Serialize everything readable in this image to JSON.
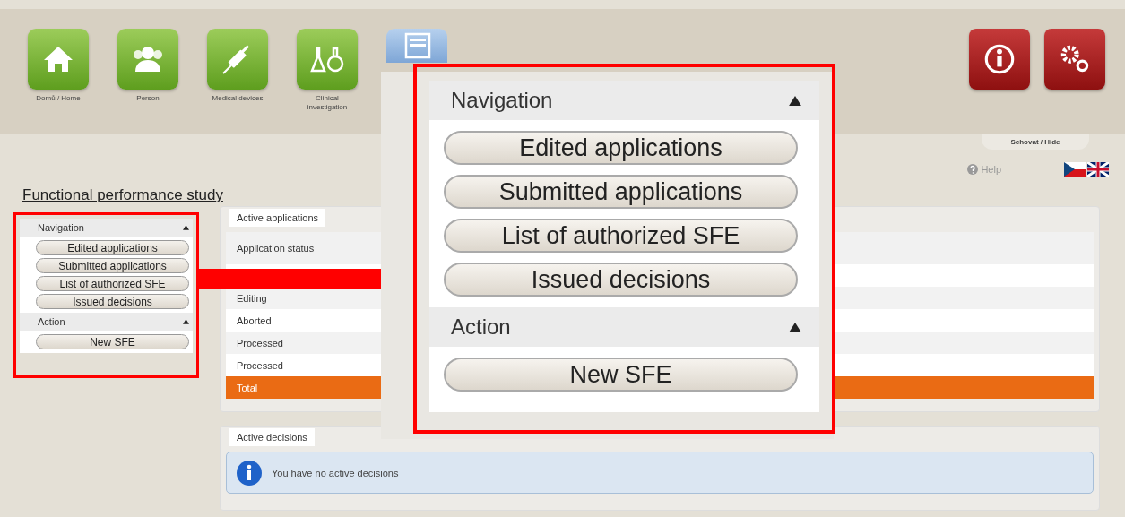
{
  "header": {
    "modules": [
      {
        "kind": "home",
        "label": "Domů / Home"
      },
      {
        "kind": "person",
        "label": "Person"
      },
      {
        "kind": "syringe",
        "label": "Medical devices"
      },
      {
        "kind": "flask",
        "label": "Clinical investigation"
      },
      {
        "kind": "document"
      }
    ],
    "tools": [
      {
        "kind": "info"
      },
      {
        "kind": "gears"
      }
    ]
  },
  "hide_tab": "Schovat / Hide",
  "help": "Help",
  "languages": [
    {
      "kind": "cz"
    },
    {
      "kind": "gb"
    }
  ],
  "page_title": "Functional performance study",
  "sidebar": {
    "sections": [
      {
        "title": "Navigation",
        "expanded": true,
        "buttons": [
          "Edited applications",
          "Submitted applications",
          "List of authorized SFE",
          "Issued decisions"
        ]
      },
      {
        "title": "Action",
        "expanded": true,
        "buttons": [
          "New SFE"
        ]
      }
    ]
  },
  "applications": {
    "tab": "Active applications",
    "column": "Application status",
    "rows": [
      {
        "kind": "blank"
      },
      {
        "kind": "normal",
        "label": "Editing"
      },
      {
        "kind": "normal",
        "label": "Aborted"
      },
      {
        "kind": "normal",
        "label": "Processed"
      },
      {
        "kind": "normal",
        "label": "Processed"
      },
      {
        "kind": "total",
        "label": "Total"
      }
    ]
  },
  "decisions": {
    "tab": "Active decisions",
    "message": "You have no active decisions"
  },
  "callout": {
    "sections": [
      {
        "title": "Navigation",
        "expanded": true,
        "buttons": [
          "Edited applications",
          "Submitted applications",
          "List of authorized SFE",
          "Issued decisions"
        ]
      },
      {
        "title": "Action",
        "expanded": true,
        "buttons": [
          "New SFE"
        ]
      }
    ]
  }
}
